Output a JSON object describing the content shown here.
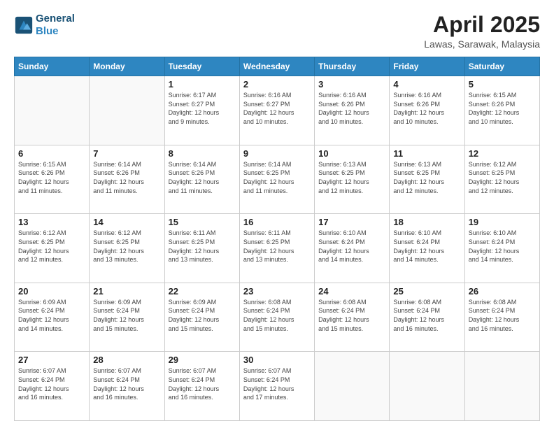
{
  "header": {
    "logo_line1": "General",
    "logo_line2": "Blue",
    "month_title": "April 2025",
    "location": "Lawas, Sarawak, Malaysia"
  },
  "days_of_week": [
    "Sunday",
    "Monday",
    "Tuesday",
    "Wednesday",
    "Thursday",
    "Friday",
    "Saturday"
  ],
  "weeks": [
    [
      {
        "day": "",
        "info": ""
      },
      {
        "day": "",
        "info": ""
      },
      {
        "day": "1",
        "info": "Sunrise: 6:17 AM\nSunset: 6:27 PM\nDaylight: 12 hours\nand 9 minutes."
      },
      {
        "day": "2",
        "info": "Sunrise: 6:16 AM\nSunset: 6:27 PM\nDaylight: 12 hours\nand 10 minutes."
      },
      {
        "day": "3",
        "info": "Sunrise: 6:16 AM\nSunset: 6:26 PM\nDaylight: 12 hours\nand 10 minutes."
      },
      {
        "day": "4",
        "info": "Sunrise: 6:16 AM\nSunset: 6:26 PM\nDaylight: 12 hours\nand 10 minutes."
      },
      {
        "day": "5",
        "info": "Sunrise: 6:15 AM\nSunset: 6:26 PM\nDaylight: 12 hours\nand 10 minutes."
      }
    ],
    [
      {
        "day": "6",
        "info": "Sunrise: 6:15 AM\nSunset: 6:26 PM\nDaylight: 12 hours\nand 11 minutes."
      },
      {
        "day": "7",
        "info": "Sunrise: 6:14 AM\nSunset: 6:26 PM\nDaylight: 12 hours\nand 11 minutes."
      },
      {
        "day": "8",
        "info": "Sunrise: 6:14 AM\nSunset: 6:26 PM\nDaylight: 12 hours\nand 11 minutes."
      },
      {
        "day": "9",
        "info": "Sunrise: 6:14 AM\nSunset: 6:25 PM\nDaylight: 12 hours\nand 11 minutes."
      },
      {
        "day": "10",
        "info": "Sunrise: 6:13 AM\nSunset: 6:25 PM\nDaylight: 12 hours\nand 12 minutes."
      },
      {
        "day": "11",
        "info": "Sunrise: 6:13 AM\nSunset: 6:25 PM\nDaylight: 12 hours\nand 12 minutes."
      },
      {
        "day": "12",
        "info": "Sunrise: 6:12 AM\nSunset: 6:25 PM\nDaylight: 12 hours\nand 12 minutes."
      }
    ],
    [
      {
        "day": "13",
        "info": "Sunrise: 6:12 AM\nSunset: 6:25 PM\nDaylight: 12 hours\nand 12 minutes."
      },
      {
        "day": "14",
        "info": "Sunrise: 6:12 AM\nSunset: 6:25 PM\nDaylight: 12 hours\nand 13 minutes."
      },
      {
        "day": "15",
        "info": "Sunrise: 6:11 AM\nSunset: 6:25 PM\nDaylight: 12 hours\nand 13 minutes."
      },
      {
        "day": "16",
        "info": "Sunrise: 6:11 AM\nSunset: 6:25 PM\nDaylight: 12 hours\nand 13 minutes."
      },
      {
        "day": "17",
        "info": "Sunrise: 6:10 AM\nSunset: 6:24 PM\nDaylight: 12 hours\nand 14 minutes."
      },
      {
        "day": "18",
        "info": "Sunrise: 6:10 AM\nSunset: 6:24 PM\nDaylight: 12 hours\nand 14 minutes."
      },
      {
        "day": "19",
        "info": "Sunrise: 6:10 AM\nSunset: 6:24 PM\nDaylight: 12 hours\nand 14 minutes."
      }
    ],
    [
      {
        "day": "20",
        "info": "Sunrise: 6:09 AM\nSunset: 6:24 PM\nDaylight: 12 hours\nand 14 minutes."
      },
      {
        "day": "21",
        "info": "Sunrise: 6:09 AM\nSunset: 6:24 PM\nDaylight: 12 hours\nand 15 minutes."
      },
      {
        "day": "22",
        "info": "Sunrise: 6:09 AM\nSunset: 6:24 PM\nDaylight: 12 hours\nand 15 minutes."
      },
      {
        "day": "23",
        "info": "Sunrise: 6:08 AM\nSunset: 6:24 PM\nDaylight: 12 hours\nand 15 minutes."
      },
      {
        "day": "24",
        "info": "Sunrise: 6:08 AM\nSunset: 6:24 PM\nDaylight: 12 hours\nand 15 minutes."
      },
      {
        "day": "25",
        "info": "Sunrise: 6:08 AM\nSunset: 6:24 PM\nDaylight: 12 hours\nand 16 minutes."
      },
      {
        "day": "26",
        "info": "Sunrise: 6:08 AM\nSunset: 6:24 PM\nDaylight: 12 hours\nand 16 minutes."
      }
    ],
    [
      {
        "day": "27",
        "info": "Sunrise: 6:07 AM\nSunset: 6:24 PM\nDaylight: 12 hours\nand 16 minutes."
      },
      {
        "day": "28",
        "info": "Sunrise: 6:07 AM\nSunset: 6:24 PM\nDaylight: 12 hours\nand 16 minutes."
      },
      {
        "day": "29",
        "info": "Sunrise: 6:07 AM\nSunset: 6:24 PM\nDaylight: 12 hours\nand 16 minutes."
      },
      {
        "day": "30",
        "info": "Sunrise: 6:07 AM\nSunset: 6:24 PM\nDaylight: 12 hours\nand 17 minutes."
      },
      {
        "day": "",
        "info": ""
      },
      {
        "day": "",
        "info": ""
      },
      {
        "day": "",
        "info": ""
      }
    ]
  ]
}
